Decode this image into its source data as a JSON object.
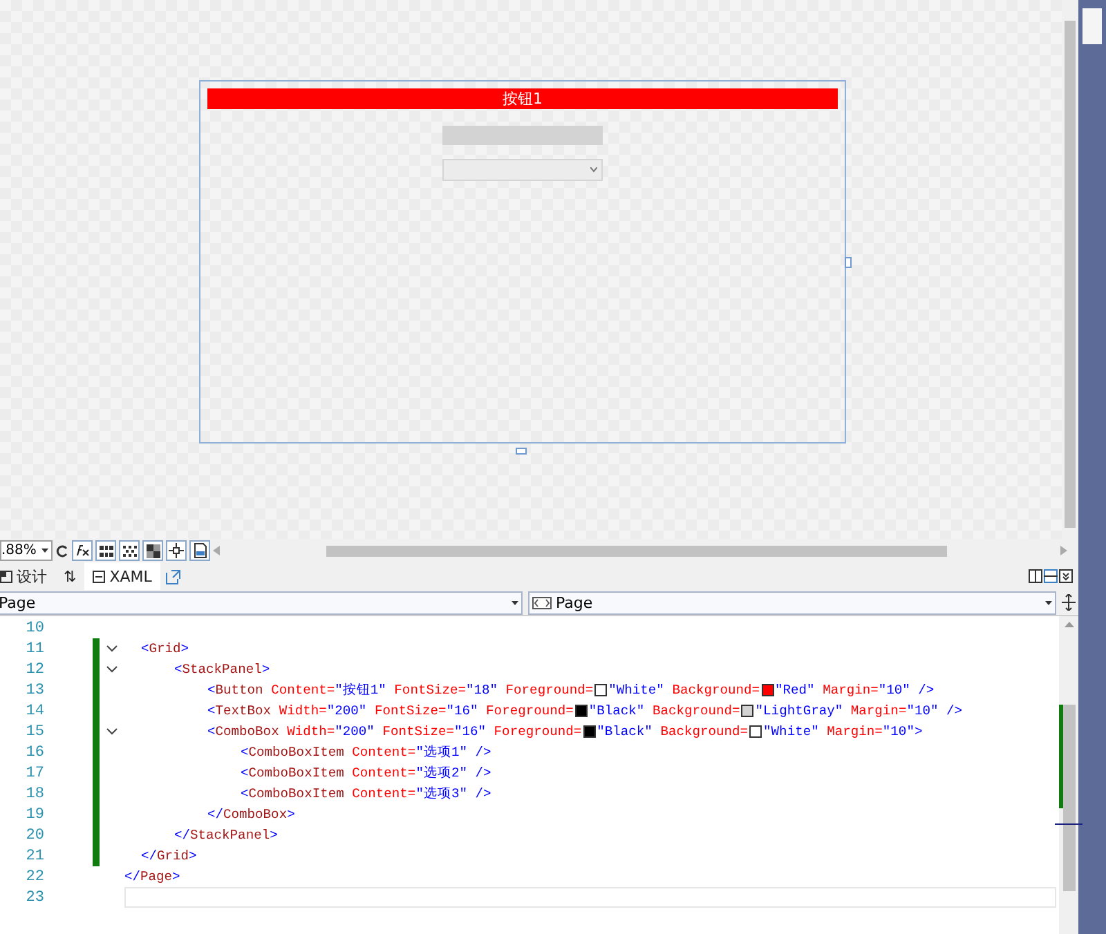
{
  "designer": {
    "controls": [
      {
        "kind": "button",
        "label": "按钮1"
      },
      {
        "kind": "textbox"
      },
      {
        "kind": "combobox"
      }
    ]
  },
  "toolbar": {
    "zoom": ".88%"
  },
  "view_tabs": [
    {
      "kind": "design",
      "label": "设计",
      "selected": false
    },
    {
      "kind": "swap",
      "label": "⇅",
      "selected": false
    },
    {
      "kind": "xaml",
      "label": "XAML",
      "selected": true
    }
  ],
  "selectors": [
    {
      "label": "Page"
    },
    {
      "label": "Page"
    }
  ],
  "code": {
    "lines": [
      {
        "children": [
          {
            "number": "10",
            "changed": false
          },
          {
            "number": "11",
            "changed": true,
            "tokens": [
              {
                "kind": "bracket",
                "text": "<"
              },
              {
                "kind": "tag",
                "text": "Grid"
              },
              {
                "kind": "bracket",
                "text": ">"
              }
            ],
            "children": [
              {
                "number": "12",
                "changed": true,
                "tokens": [
                  {
                    "kind": "bracket",
                    "text": "<"
                  },
                  {
                    "kind": "tag",
                    "text": "StackPanel"
                  },
                  {
                    "kind": "bracket",
                    "text": ">"
                  }
                ],
                "children": [
                  {
                    "number": "13",
                    "changed": true,
                    "tokens": [
                      {
                        "kind": "bracket",
                        "text": "<"
                      },
                      {
                        "kind": "tag",
                        "text": "Button"
                      },
                      {
                        "kind": "attr",
                        "text": " Content="
                      },
                      {
                        "kind": "value",
                        "text": "\"按钮1\""
                      },
                      {
                        "kind": "attr",
                        "text": " FontSize="
                      },
                      {
                        "kind": "value",
                        "text": "\"18\""
                      },
                      {
                        "kind": "attr",
                        "text": " Foreground="
                      },
                      {
                        "kind": "swatch",
                        "color": "#ffffff"
                      },
                      {
                        "kind": "value",
                        "text": "\"White\""
                      },
                      {
                        "kind": "attr",
                        "text": " Background="
                      },
                      {
                        "kind": "swatch",
                        "color": "#ff0000"
                      },
                      {
                        "kind": "value",
                        "text": "\"Red\""
                      },
                      {
                        "kind": "attr",
                        "text": " Margin="
                      },
                      {
                        "kind": "value",
                        "text": "\"10\""
                      },
                      {
                        "kind": "bracket",
                        "text": " />"
                      }
                    ]
                  },
                  {
                    "number": "14",
                    "changed": true,
                    "tokens": [
                      {
                        "kind": "bracket",
                        "text": "<"
                      },
                      {
                        "kind": "tag",
                        "text": "TextBox"
                      },
                      {
                        "kind": "attr",
                        "text": " Width="
                      },
                      {
                        "kind": "value",
                        "text": "\"200\""
                      },
                      {
                        "kind": "attr",
                        "text": " FontSize="
                      },
                      {
                        "kind": "value",
                        "text": "\"16\""
                      },
                      {
                        "kind": "attr",
                        "text": " Foreground="
                      },
                      {
                        "kind": "swatch",
                        "color": "#000000"
                      },
                      {
                        "kind": "value",
                        "text": "\"Black\""
                      },
                      {
                        "kind": "attr",
                        "text": " Background="
                      },
                      {
                        "kind": "swatch",
                        "color": "#d3d3d3"
                      },
                      {
                        "kind": "value",
                        "text": "\"LightGray\""
                      },
                      {
                        "kind": "attr",
                        "text": " Margin="
                      },
                      {
                        "kind": "value",
                        "text": "\"10\""
                      },
                      {
                        "kind": "bracket",
                        "text": " />"
                      }
                    ]
                  },
                  {
                    "number": "15",
                    "changed": true,
                    "tokens": [
                      {
                        "kind": "bracket",
                        "text": "<"
                      },
                      {
                        "kind": "tag",
                        "text": "ComboBox"
                      },
                      {
                        "kind": "attr",
                        "text": " Width="
                      },
                      {
                        "kind": "value",
                        "text": "\"200\""
                      },
                      {
                        "kind": "attr",
                        "text": " FontSize="
                      },
                      {
                        "kind": "value",
                        "text": "\"16\""
                      },
                      {
                        "kind": "attr",
                        "text": " Foreground="
                      },
                      {
                        "kind": "swatch",
                        "color": "#000000"
                      },
                      {
                        "kind": "value",
                        "text": "\"Black\""
                      },
                      {
                        "kind": "attr",
                        "text": " Background="
                      },
                      {
                        "kind": "swatch",
                        "color": "#ffffff"
                      },
                      {
                        "kind": "value",
                        "text": "\"White\""
                      },
                      {
                        "kind": "attr",
                        "text": " Margin="
                      },
                      {
                        "kind": "value",
                        "text": "\"10\""
                      },
                      {
                        "kind": "bracket",
                        "text": ">"
                      }
                    ],
                    "children": [
                      {
                        "number": "16",
                        "changed": true,
                        "tokens": [
                          {
                            "kind": "bracket",
                            "text": "<"
                          },
                          {
                            "kind": "tag",
                            "text": "ComboBoxItem"
                          },
                          {
                            "kind": "attr",
                            "text": " Content="
                          },
                          {
                            "kind": "value",
                            "text": "\"选项1\""
                          },
                          {
                            "kind": "bracket",
                            "text": " />"
                          }
                        ]
                      },
                      {
                        "number": "17",
                        "changed": true,
                        "tokens": [
                          {
                            "kind": "bracket",
                            "text": "<"
                          },
                          {
                            "kind": "tag",
                            "text": "ComboBoxItem"
                          },
                          {
                            "kind": "attr",
                            "text": " Content="
                          },
                          {
                            "kind": "value",
                            "text": "\"选项2\""
                          },
                          {
                            "kind": "bracket",
                            "text": " />"
                          }
                        ]
                      },
                      {
                        "number": "18",
                        "changed": true,
                        "tokens": [
                          {
                            "kind": "bracket",
                            "text": "<"
                          },
                          {
                            "kind": "tag",
                            "text": "ComboBoxItem"
                          },
                          {
                            "kind": "attr",
                            "text": " Content="
                          },
                          {
                            "kind": "value",
                            "text": "\"选项3\""
                          },
                          {
                            "kind": "bracket",
                            "text": " />"
                          }
                        ]
                      }
                    ]
                  },
                  {
                    "number": "19",
                    "changed": true,
                    "tokens": [
                      {
                        "kind": "bracket",
                        "text": "</"
                      },
                      {
                        "kind": "tag",
                        "text": "ComboBox"
                      },
                      {
                        "kind": "bracket",
                        "text": ">"
                      }
                    ]
                  }
                ]
              },
              {
                "number": "20",
                "changed": true,
                "tokens": [
                  {
                    "kind": "bracket",
                    "text": "</"
                  },
                  {
                    "kind": "tag",
                    "text": "StackPanel"
                  },
                  {
                    "kind": "bracket",
                    "text": ">"
                  }
                ]
              }
            ]
          },
          {
            "number": "21",
            "changed": true,
            "tokens": [
              {
                "kind": "bracket",
                "text": "</"
              },
              {
                "kind": "tag",
                "text": "Grid"
              },
              {
                "kind": "bracket",
                "text": ">"
              }
            ]
          }
        ]
      },
      {
        "number": "22",
        "changed": false,
        "tokens": [
          {
            "kind": "bracket",
            "text": "</"
          },
          {
            "kind": "tag",
            "text": "Page"
          },
          {
            "kind": "bracket",
            "text": ">"
          }
        ]
      },
      {
        "number": "23",
        "changed": false,
        "current": true
      }
    ]
  }
}
